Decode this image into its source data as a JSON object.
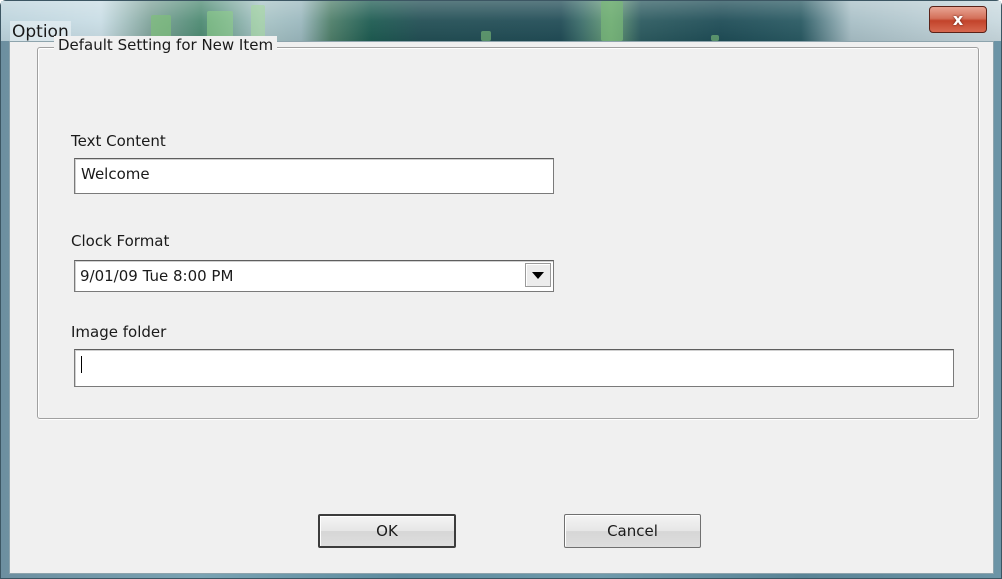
{
  "window": {
    "title": "Option",
    "close_glyph": "x"
  },
  "group": {
    "legend": "Default Setting for New Item"
  },
  "text_content": {
    "label": "Text Content",
    "value": "Welcome"
  },
  "clock_format": {
    "label": "Clock Format",
    "selected": "9/01/09 Tue 8:00 PM"
  },
  "image_folder": {
    "label": "Image folder",
    "value": ""
  },
  "buttons": {
    "ok": "OK",
    "cancel": "Cancel"
  },
  "colors": {
    "dialog_bg": "#f0f0f0",
    "close_button": "#c2432b"
  },
  "icons": {
    "close": "close-icon",
    "dropdown": "chevron-down-icon"
  }
}
